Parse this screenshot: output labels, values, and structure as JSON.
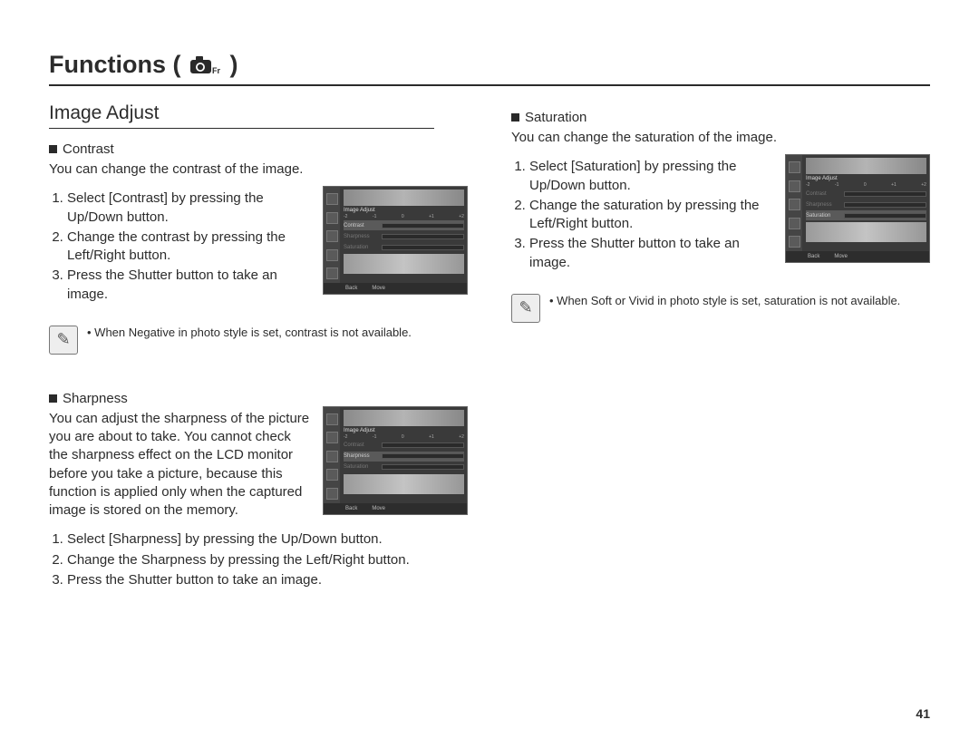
{
  "page": {
    "title_prefix": "Functions (",
    "title_suffix": ")",
    "number": "41"
  },
  "left": {
    "section": "Image Adjust",
    "contrast": {
      "heading": "Contrast",
      "desc": "You can change the contrast of the image.",
      "steps": [
        "Select [Contrast] by pressing the Up/Down button.",
        "Change the contrast by pressing the Left/Right button.",
        "Press the Shutter button to take an image."
      ],
      "note": "When Negative in photo style is set, contrast is not available."
    },
    "sharpness": {
      "heading": "Sharpness",
      "desc": "You can adjust the sharpness of the picture you are about to take. You cannot check the sharpness effect on the LCD monitor before you take a picture, because this function is applied only when the captured image is stored on the memory.",
      "steps": [
        "Select [Sharpness] by pressing the Up/Down button.",
        "Change the Sharpness by pressing the Left/Right button.",
        "Press the Shutter button to take an image."
      ]
    }
  },
  "right": {
    "saturation": {
      "heading": "Saturation",
      "desc": "You can change the saturation of the image.",
      "steps": [
        "Select [Saturation] by pressing the Up/Down button.",
        "Change the saturation by pressing the Left/Right button.",
        "Press the Shutter button to take an image."
      ],
      "note": "When Soft or Vivid in photo style is set, saturation is not available."
    }
  },
  "lcd": {
    "title": "Image Adjust",
    "rows": [
      "Contrast",
      "Sharpness",
      "Saturation"
    ],
    "ticks": [
      "-2",
      "-1",
      "0",
      "+1",
      "+2"
    ],
    "back": "Back",
    "move": "Move"
  }
}
